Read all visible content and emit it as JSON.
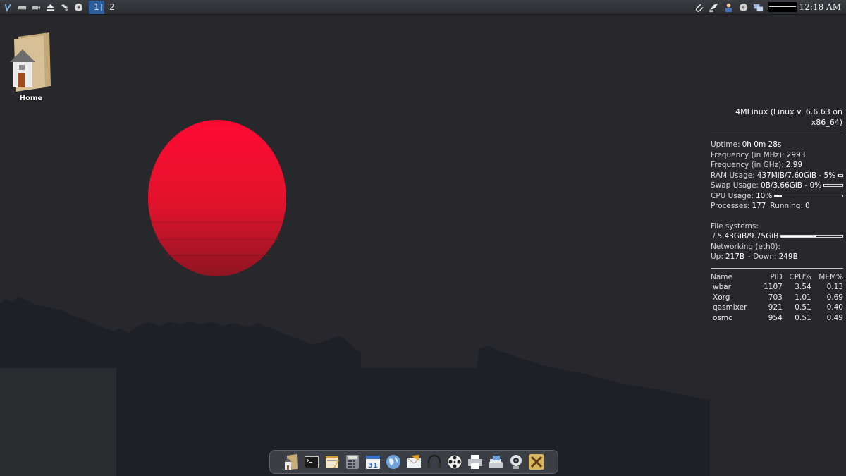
{
  "top_panel": {
    "launchers": [
      {
        "name": "4mlinux-menu-icon"
      },
      {
        "name": "drive-icon"
      },
      {
        "name": "drive-mount-icon"
      },
      {
        "name": "eject-icon"
      },
      {
        "name": "network-share-icon"
      },
      {
        "name": "cdrom-icon"
      }
    ],
    "workspaces": [
      {
        "label": "1",
        "active": true
      },
      {
        "label": "2",
        "active": false
      }
    ],
    "tray": [
      {
        "name": "paperclip-icon"
      },
      {
        "name": "screenshot-icon"
      },
      {
        "name": "user-icon"
      },
      {
        "name": "disk-icon"
      },
      {
        "name": "network-icon"
      }
    ],
    "clock": "12:18 AM"
  },
  "desktop": {
    "home_label": "Home"
  },
  "conky": {
    "title": "4MLinux (Linux v. 6.6.63 on x86_64)",
    "uptime_label": "Uptime:",
    "uptime": "0h 0m 28s",
    "freq_mhz_label": "Frequency (in MHz):",
    "freq_mhz": "2993",
    "freq_ghz_label": "Frequency (in GHz):",
    "freq_ghz": "2.99",
    "ram_label": "RAM Usage:",
    "ram": "437MiB/7.60GiB - 5%",
    "ram_fraction": 0.05,
    "swap_label": "Swap Usage:",
    "swap": "0B/3.66GiB - 0%",
    "swap_fraction": 0.0,
    "cpu_label": "CPU Usage:",
    "cpu": "10%",
    "cpu_fraction": 0.1,
    "processes_label": "Processes:",
    "processes": "177",
    "running_label": "Running:",
    "running": "0",
    "fs_label": "File systems:",
    "fs_mount": "/",
    "fs_usage": "5.43GiB/9.75GiB",
    "fs_fraction": 0.557,
    "net_label": "Networking (eth0):",
    "up_label": "Up:",
    "up": "217B",
    "down_label": "- Down:",
    "down": "249B",
    "process_table": {
      "headers": [
        "Name",
        "PID",
        "CPU%",
        "MEM%"
      ],
      "rows": [
        [
          "wbar",
          "1107",
          "3.54",
          "0.13"
        ],
        [
          "Xorg",
          "703",
          "1.01",
          "0.69"
        ],
        [
          "qasmixer",
          "921",
          "0.51",
          "0.40"
        ],
        [
          "osmo",
          "954",
          "0.51",
          "0.49"
        ]
      ]
    }
  },
  "dock": {
    "items": [
      {
        "name": "file-manager-icon"
      },
      {
        "name": "terminal-icon"
      },
      {
        "name": "text-editor-icon"
      },
      {
        "name": "calculator-icon"
      },
      {
        "name": "calendar-icon",
        "text": "31"
      },
      {
        "name": "web-browser-icon"
      },
      {
        "name": "mail-icon"
      },
      {
        "name": "audio-player-icon"
      },
      {
        "name": "video-player-icon"
      },
      {
        "name": "printer-icon"
      },
      {
        "name": "scanner-icon"
      },
      {
        "name": "webcam-icon"
      },
      {
        "name": "games-icon"
      }
    ]
  },
  "colors": {
    "panel": "#35363a",
    "workspace_active": "#2c5d9c",
    "sun": "#e8132d",
    "sky": "#28282c"
  }
}
